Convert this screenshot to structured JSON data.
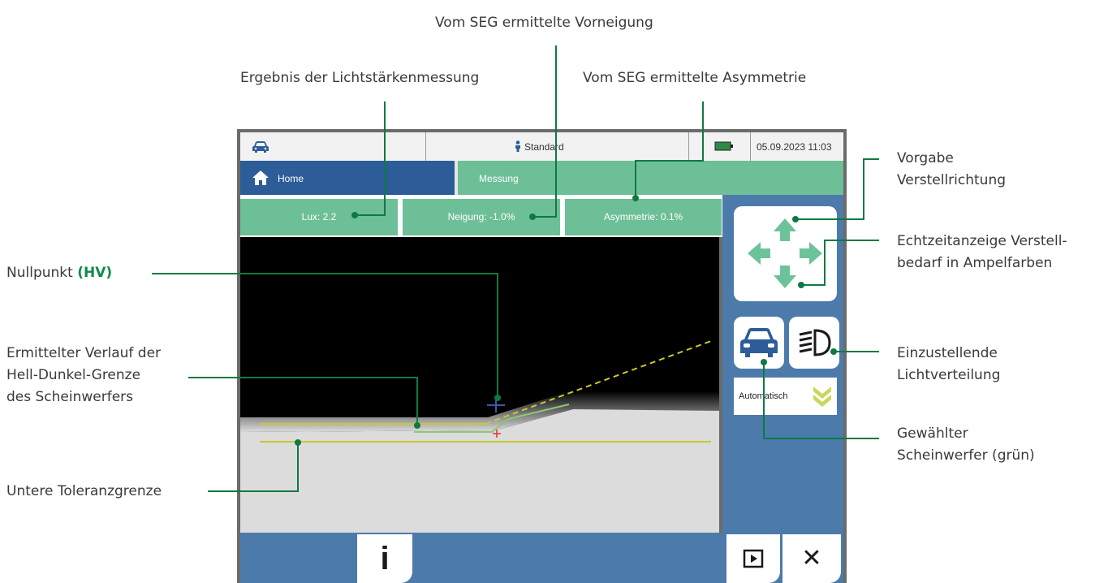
{
  "annotations": {
    "vorneigung": "Vom SEG ermittelte Vorneigung",
    "lichtstaerke": "Ergebnis der Lichtstärkenmessung",
    "asymmetrie": "Vom SEG ermittelte Asymmetrie",
    "vorgabe_line1": "Vorgabe",
    "vorgabe_line2": "Verstellrichtung",
    "echtzeit_line1": "Echtzeitanzeige Verstell-",
    "echtzeit_line2": "bedarf in Ampelfarben",
    "nullpunkt": "Nullpunkt",
    "nullpunkt_hl": "(HV)",
    "verlauf_line1": "Ermittelter Verlauf der",
    "verlauf_line2": "Hell-Dunkel-Grenze",
    "verlauf_line3": "des Scheinwerfers",
    "lichtverteilung_line1": "Einzustellende",
    "lichtverteilung_line2": "Lichtverteilung",
    "gewaehlt_line1": "Gewählter",
    "gewaehlt_line2": "Scheinwerfer (grün)",
    "toleranz": "Untere Toleranzgrenze"
  },
  "statusbar": {
    "profile": "Standard",
    "battery": "Netz",
    "datetime": "05.09.2023 11:03"
  },
  "tabs": {
    "home": "Home",
    "messung": "Messung"
  },
  "values": {
    "lux": "Lux: 2.2",
    "neigung": "Neigung: -1.0%",
    "asymmetrie": "Asymmetrie: 0.1%"
  },
  "controls": {
    "auto_label": "Automatisch",
    "info_glyph": "i",
    "close_glyph": "✕"
  },
  "colors": {
    "accent_green": "#0e8a4a",
    "header_green": "#6dbf97",
    "nav_blue": "#2c5d98",
    "panel_blue": "#4c7bab",
    "cutoff_line": "#c8c832"
  },
  "icons": {
    "statusbar_car": "car-icon",
    "profile": "person-icon",
    "battery": "battery-icon",
    "home": "home-icon",
    "direction": "four-direction-arrows-icon",
    "vehicle": "car-front-icon",
    "beam": "low-beam-icon",
    "auto": "double-chevron-down-icon",
    "info": "info-icon",
    "play": "play-icon",
    "close": "close-icon"
  }
}
